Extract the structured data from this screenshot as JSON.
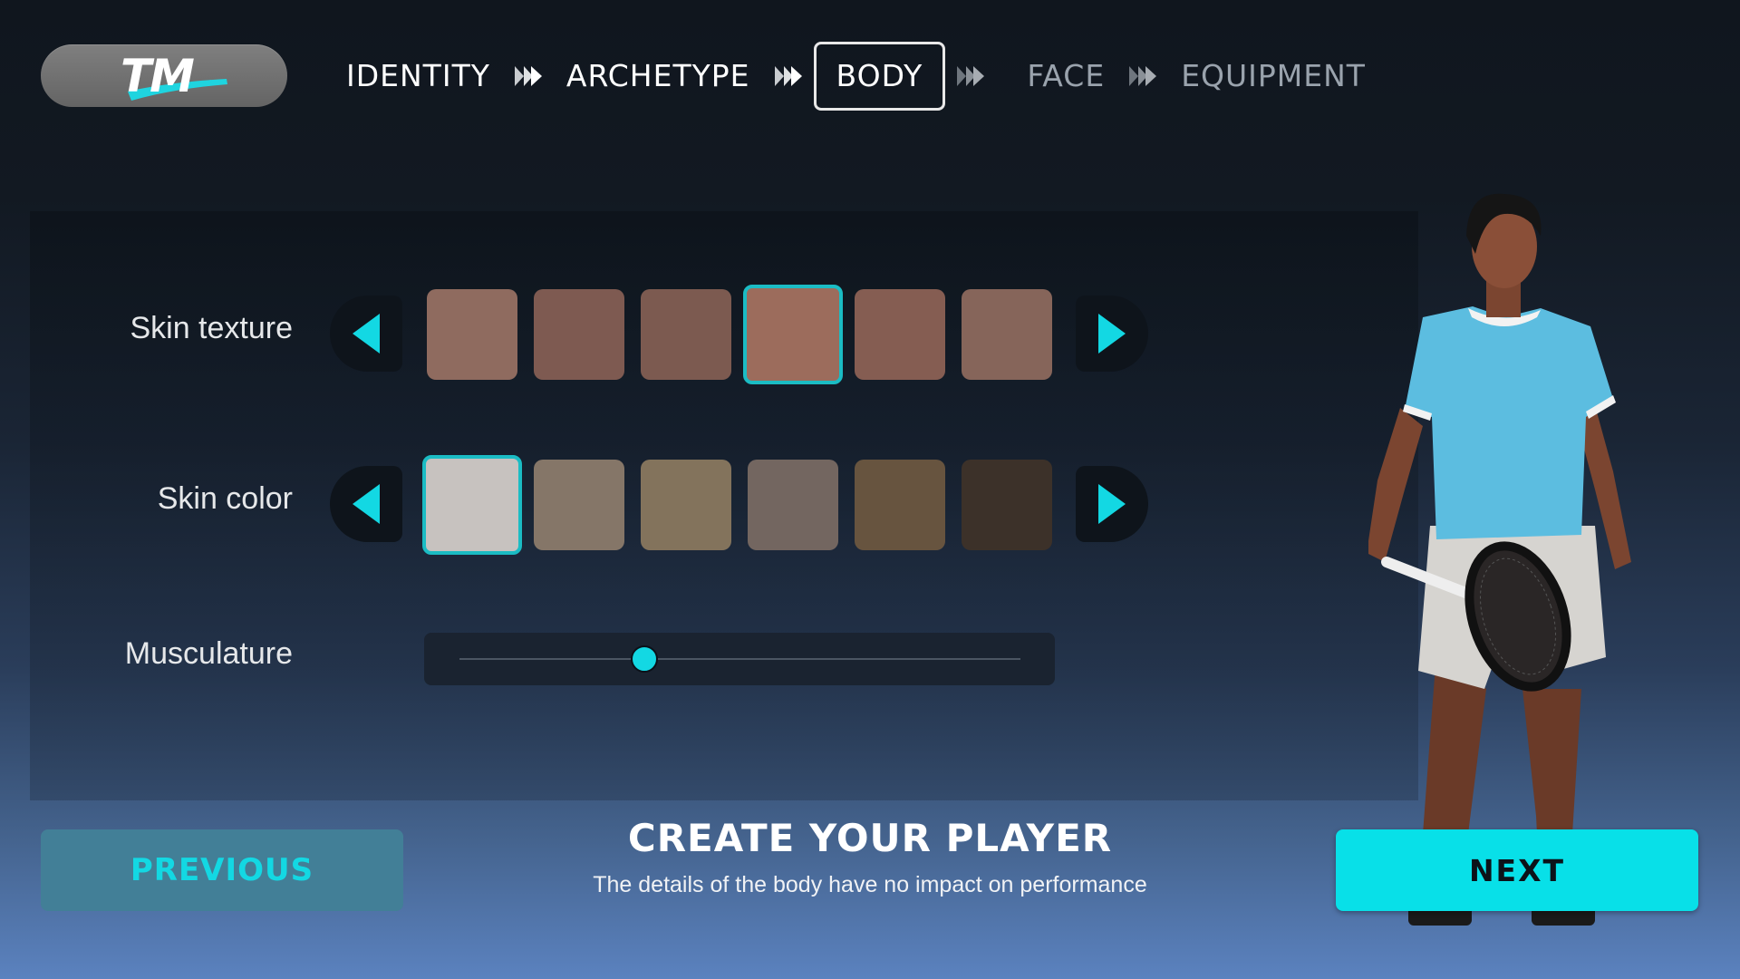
{
  "header": {
    "logo_text": "TM",
    "steps": [
      {
        "label": "IDENTITY",
        "state": "done"
      },
      {
        "label": "ARCHETYPE",
        "state": "done"
      },
      {
        "label": "BODY",
        "state": "active"
      },
      {
        "label": "FACE",
        "state": "upcoming"
      },
      {
        "label": "EQUIPMENT",
        "state": "upcoming"
      }
    ],
    "step_separator_icon": "double-chevron-right-icon"
  },
  "body_editor": {
    "skin_texture": {
      "label": "Skin texture",
      "selected_index": 3,
      "swatches": [
        "#8f6b5f",
        "#7e5a51",
        "#7c5a50",
        "#9c6c5c",
        "#855d52",
        "#86655a"
      ]
    },
    "skin_color": {
      "label": "Skin color",
      "selected_index": 0,
      "swatches": [
        "#c7c2bf",
        "#857668",
        "#83735c",
        "#736660",
        "#67543f",
        "#3c3129"
      ]
    },
    "musculature": {
      "label": "Musculature",
      "value_fraction": 0.33
    }
  },
  "footer": {
    "previous_label": "PREVIOUS",
    "next_label": "NEXT",
    "title": "CREATE YOUR PLAYER",
    "subtitle": "The details of the body have no impact on performance"
  },
  "colors": {
    "accent": "#13d8e3",
    "next_button": "#08e0e8",
    "previous_button": "#427f97",
    "shirt": "#5cbde0"
  }
}
